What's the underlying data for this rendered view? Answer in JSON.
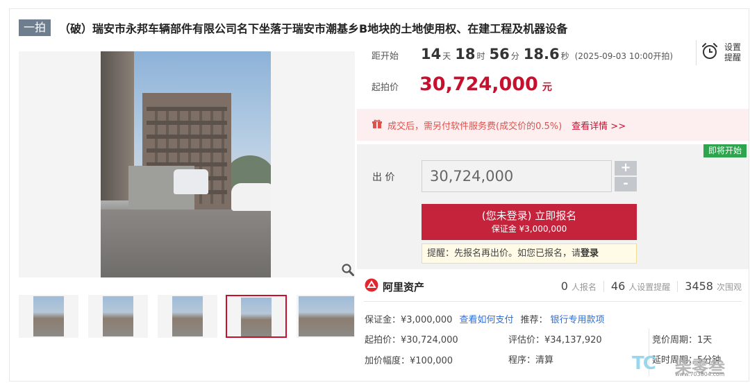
{
  "title": {
    "badge": "一拍",
    "text": "（破）瑞安市永邦车辆部件有限公司名下坐落于瑞安市潮基乡B地块的土地使用权、在建工程及机器设备"
  },
  "countdown": {
    "label": "距开始",
    "days": "14",
    "days_unit": "天",
    "hours": "18",
    "hours_unit": "时",
    "minutes": "56",
    "minutes_unit": "分",
    "seconds": "18.6",
    "seconds_unit": "秒",
    "start_time": "(2025-09-03 10:00开拍)"
  },
  "reminder": {
    "label": "设置提醒"
  },
  "start_price": {
    "label": "起拍价",
    "value": "30,724,000",
    "unit": "元"
  },
  "notice": {
    "text": "成交后，需另付软件服务费(成交价的0.5%)",
    "link": "查看详情 >>"
  },
  "status_tag": "即将开始",
  "bid": {
    "label": "出 价",
    "value": "30,724,000",
    "plus": "+",
    "minus": "-",
    "signup_label": "(您未登录) 立即报名",
    "deposit_label": "保证金 ¥3,000,000",
    "tip_text": "提醒：先报名再出价。如您已报名，请",
    "tip_login": "登录"
  },
  "platform": {
    "name": "阿里资产"
  },
  "stats": [
    {
      "num": "0",
      "label": "人报名"
    },
    {
      "num": "46",
      "label": "人设置提醒"
    },
    {
      "num": "3458",
      "label": "次围观"
    }
  ],
  "info": {
    "deposit": "保证金：¥3,000,000",
    "how_to_pay": "查看如何支付",
    "recommend_label": "推荐：",
    "recommend_link": "银行专用款项",
    "start_price": "起拍价：¥30,724,000",
    "appraisal": "评估价：¥34,137,920",
    "cycle": "竞价周期：1天",
    "increment": "加价幅度：¥100,000",
    "procedure": "程序：清算",
    "delay": "延时周期：5分钟"
  },
  "watermark": {
    "brand": "柴零叁",
    "url": "www.703804.com"
  },
  "colors": {
    "accent": "#c8102e",
    "link": "#2f6ed8",
    "tag_green": "#2ea44f"
  }
}
